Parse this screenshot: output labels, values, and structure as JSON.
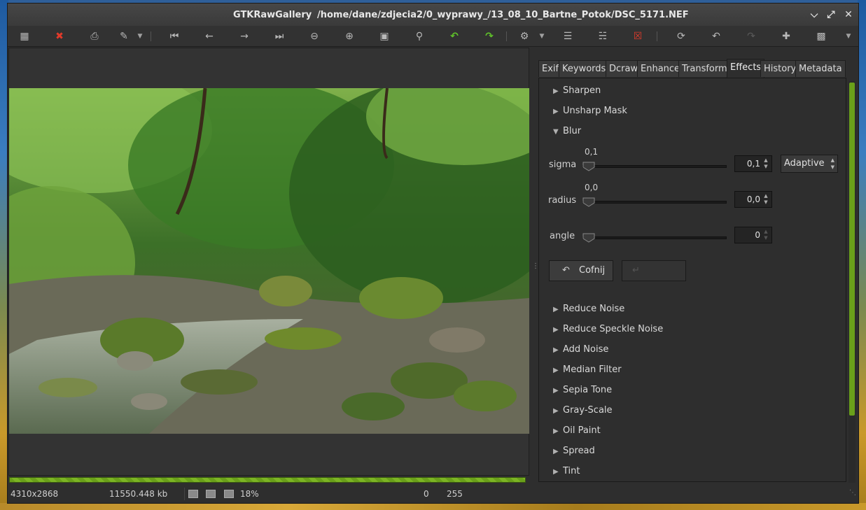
{
  "window": {
    "app_title": "GTKRawGallery",
    "path": "/home/dane/zdjecia2/0_wyprawy_/13_08_10_Bartne_Potok/DSC_5171.NEF",
    "controls": [
      "minimize-icon",
      "maximize-icon",
      "close-icon"
    ]
  },
  "toolbar": {
    "icons": [
      "gallery-view-icon",
      "delete-icon",
      "print-icon",
      "brush-icon",
      "first-image-icon",
      "previous-image-icon",
      "next-image-icon",
      "last-image-icon",
      "zoom-out-icon",
      "zoom-in-icon",
      "fit-screen-icon",
      "zoom-100-icon",
      "rotate-left-icon",
      "rotate-right-icon",
      "settings-icon",
      "list-icon",
      "properties-icon",
      "close-panel-icon",
      "refresh-icon",
      "undo-icon",
      "redo-icon",
      "add-icon",
      "image-icon"
    ],
    "colors": {
      "delete": "#e23a2a",
      "rotate": "#5fc12a",
      "accent": "#6aa01a"
    }
  },
  "tabs": [
    "Exif",
    "Keywords",
    "Dcraw",
    "Enhance",
    "Transform",
    "Effects",
    "History",
    "Metadata"
  ],
  "active_tab": "Effects",
  "effects": {
    "collapsed_top": [
      "Sharpen",
      "Unsharp Mask"
    ],
    "expanded": "Blur",
    "blur": {
      "sigma": {
        "label": "sigma",
        "value": "0,1",
        "spin": "0,1"
      },
      "radius": {
        "label": "radius",
        "value": "0,0",
        "spin": "0,0"
      },
      "angle": {
        "label": "angle",
        "spin": "0"
      },
      "mode": "Adaptive",
      "undo_label": "Cofnij"
    },
    "collapsed_bottom": [
      "Reduce Noise",
      "Reduce Speckle Noise",
      "Add Noise",
      "Median Filter",
      "Sepia Tone",
      "Gray-Scale",
      "Oil Paint",
      "Spread",
      "Tint"
    ]
  },
  "status": {
    "dimensions": "4310x2868",
    "size": "11550.448 kb",
    "zoom": "18%",
    "level_min": "0",
    "level_max": "255"
  }
}
